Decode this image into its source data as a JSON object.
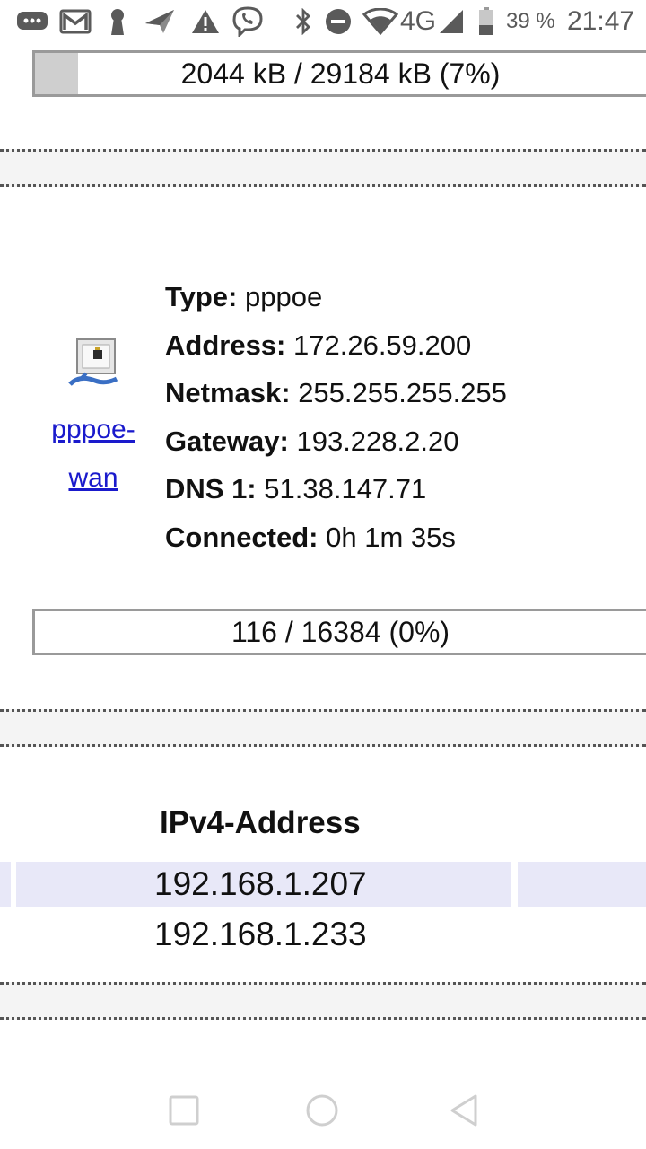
{
  "status_bar": {
    "icons": [
      "chat-icon",
      "gmail-icon",
      "keyhole-icon",
      "send-icon",
      "warning-icon",
      "viber-icon",
      "bluetooth-icon",
      "do-not-disturb-icon",
      "wifi-icon"
    ],
    "network": "4G",
    "battery_percent": "39 %",
    "battery_level": 0.39,
    "time": "21:47"
  },
  "memory_bar": {
    "label": "2044 kB / 29184 kB (7%)",
    "fraction": 0.07
  },
  "interface": {
    "link_line1": "pppoe-",
    "link_line2": "wan",
    "fields": [
      {
        "key": "Type:",
        "value": "pppoe"
      },
      {
        "key": "Address:",
        "value": "172.26.59.200"
      },
      {
        "key": "Netmask:",
        "value": "255.255.255.255"
      },
      {
        "key": "Gateway:",
        "value": "193.228.2.20"
      },
      {
        "key": "DNS 1:",
        "value": "51.38.147.71"
      },
      {
        "key": "Connected:",
        "value": "0h 1m 35s"
      }
    ]
  },
  "conntrack_bar": {
    "label": "116 / 16384 (0%)",
    "fraction": 0.0
  },
  "ipv4_table": {
    "header": "IPv4-Address",
    "rows": [
      "192.168.1.207",
      "192.168.1.233"
    ]
  },
  "colors": {
    "row_highlight": "#e8e8f8",
    "link": "#1a1acc",
    "separator_bg": "#f4f4f4"
  }
}
